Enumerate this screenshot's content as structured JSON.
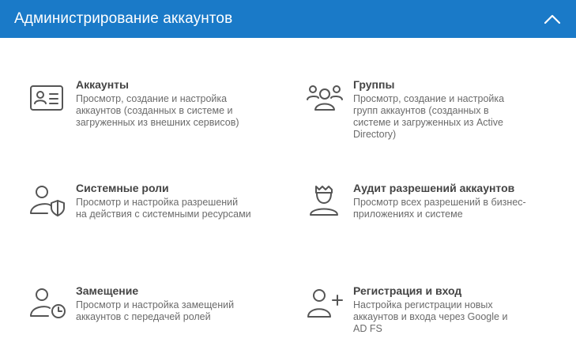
{
  "header": {
    "title": "Администрирование аккаунтов",
    "collapse_icon": "chevron-up-icon"
  },
  "items": [
    {
      "icon": "id-card-icon",
      "title": "Аккаунты",
      "desc_lines": [
        "Просмотр, создание и настройка",
        "аккаунтов (созданных в системе и",
        "загруженных из внешних сервисов)"
      ]
    },
    {
      "icon": "group-icon",
      "title": "Группы",
      "desc_lines": [
        "Просмотр, создание и настройка",
        "групп аккаунтов (созданных в",
        "системе и загруженных из Active",
        "Directory)"
      ]
    },
    {
      "icon": "user-shield-icon",
      "title": "Системные роли",
      "desc_lines": [
        "Просмотр и настройка разрешений",
        "на действия с системными ресурсами"
      ]
    },
    {
      "icon": "auditor-icon",
      "title": "Аудит разрешений аккаунтов",
      "desc_lines": [
        "Просмотр всех разрешений в бизнес-",
        "приложениях и системе"
      ]
    },
    {
      "icon": "user-clock-icon",
      "title": "Замещение",
      "desc_lines": [
        "Просмотр и настройка замещений",
        "аккаунтов с передачей ролей"
      ]
    },
    {
      "icon": "user-add-icon",
      "title": "Регистрация и вход",
      "desc_lines": [
        "Настройка регистрации новых",
        "аккаунтов и входа через Google и",
        "AD FS"
      ]
    }
  ]
}
